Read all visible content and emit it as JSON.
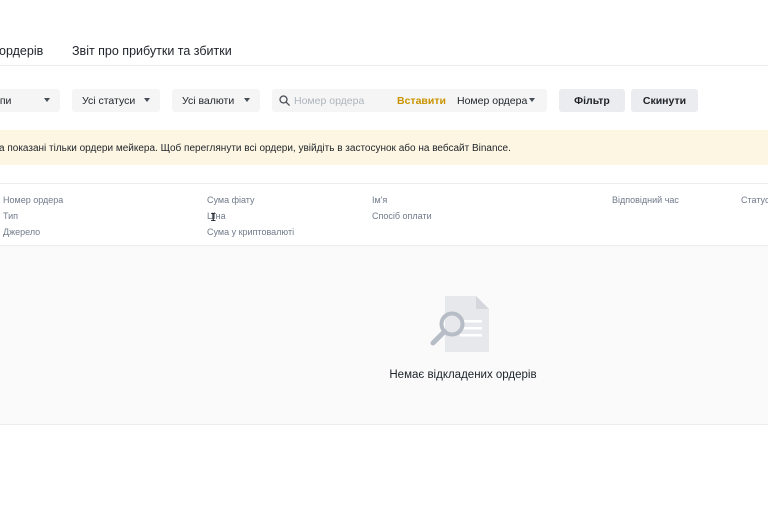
{
  "tabs": {
    "orders": "ордерів",
    "pnl_report": "Звіт про прибутки та збитки"
  },
  "filters": {
    "types": "ипи",
    "statuses": "Усі статуси",
    "currencies": "Усі валюти",
    "search_placeholder": "Номер ордера",
    "paste": "Вставити",
    "search_type": "Номер ордера",
    "filter_button": "Фільтр",
    "reset_button": "Скинути"
  },
  "notice": "а показані тільки ордери мейкера. Щоб переглянути всі ордери, увійдіть в застосунок або на вебсайт Binance.",
  "table": {
    "headers": {
      "order_number": "Номер ордера",
      "type": "Тип",
      "source": "Джерело",
      "fiat_amount": "Сума фіату",
      "price": "Ціна",
      "crypto_amount": "Сума у криптовалюті",
      "name": "Ім'я",
      "payment_method": "Спосіб оплати",
      "response_time": "Відповідний час",
      "status": "Статус"
    }
  },
  "empty_state": {
    "text": "Немає відкладених ордерів"
  },
  "colors": {
    "accent": "#c99400",
    "notice_bg": "#fdf6e3",
    "muted_text": "#707a8a"
  }
}
